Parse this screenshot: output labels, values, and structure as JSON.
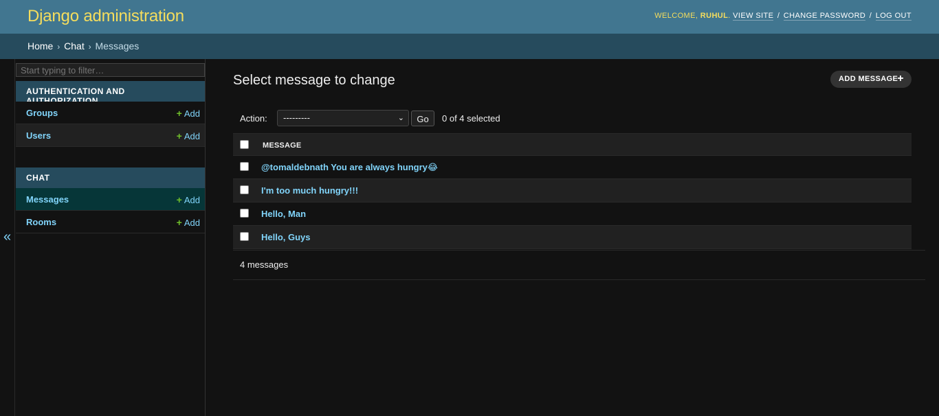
{
  "header": {
    "branding": "Django administration",
    "welcome": "Welcome,",
    "username": "ruhul",
    "view_site": "View site",
    "change_password": "Change password",
    "log_out": "Log out"
  },
  "breadcrumbs": {
    "home": "Home",
    "app": "Chat",
    "current": "Messages",
    "separator": "›"
  },
  "sidebar": {
    "filter_placeholder": "Start typing to filter…",
    "collapse_glyph": "«",
    "modules": [
      {
        "caption": "Authentication and Authorization",
        "items": [
          {
            "label": "Groups",
            "add": "Add"
          },
          {
            "label": "Users",
            "add": "Add"
          }
        ]
      },
      {
        "caption": "Chat",
        "items": [
          {
            "label": "Messages",
            "add": "Add"
          },
          {
            "label": "Rooms",
            "add": "Add"
          }
        ]
      }
    ]
  },
  "main": {
    "title": "Select message to change",
    "add_button": "Add message",
    "action_label": "Action:",
    "action_selected": "---------",
    "go_button": "Go",
    "selected_count": "0 of 4 selected",
    "column_header": "Message",
    "rows": [
      "@tomaldebnath You are always hungry😂",
      "I'm too much hungry!!!",
      "Hello, Man",
      "Hello, Guys"
    ],
    "paginator": "4 messages"
  },
  "colors": {
    "header_bg": "#417690",
    "breadcrumb_bg": "#264b5d",
    "branding": "#f5dd5d",
    "link": "#81d4fa",
    "add_plus": "#70bf2b",
    "current_row": "#063638"
  },
  "icons": {
    "add": "plus-icon",
    "collapse": "double-chevron-left-icon",
    "select_arrow": "chevron-down-icon"
  }
}
